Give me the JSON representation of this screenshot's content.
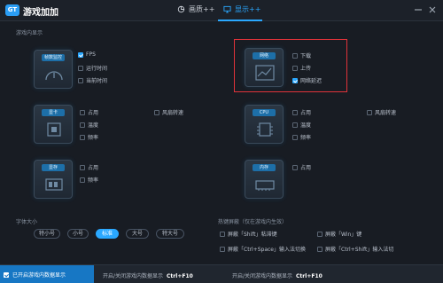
{
  "app": {
    "logo_text": "GT",
    "name": "游戏加加"
  },
  "tabs": [
    {
      "label": "画质++"
    },
    {
      "label": "显示++"
    }
  ],
  "section_display_title": "游戏内显示",
  "modules": {
    "fps": {
      "tile_label": "帧数监控",
      "options": [
        {
          "label": "FPS",
          "checked": true
        },
        {
          "label": "运行时间",
          "checked": false
        },
        {
          "label": "当前时间",
          "checked": false
        }
      ]
    },
    "network": {
      "tile_label": "网络",
      "options": [
        {
          "label": "下载",
          "checked": false
        },
        {
          "label": "上传",
          "checked": false
        },
        {
          "label": "网络延迟",
          "checked": true
        }
      ]
    },
    "gpu": {
      "tile_label": "显卡",
      "options": [
        {
          "label": "占用",
          "checked": false
        },
        {
          "label": "温度",
          "checked": false
        },
        {
          "label": "频率",
          "checked": false
        },
        {
          "label": "风扇转速",
          "checked": false
        }
      ]
    },
    "cpu": {
      "tile_label": "CPU",
      "options": [
        {
          "label": "占用",
          "checked": false
        },
        {
          "label": "温度",
          "checked": false
        },
        {
          "label": "频率",
          "checked": false
        },
        {
          "label": "风扇转速",
          "checked": false
        }
      ]
    },
    "vram": {
      "tile_label": "显存",
      "options": [
        {
          "label": "占用",
          "checked": false
        },
        {
          "label": "频率",
          "checked": false
        }
      ]
    },
    "ram": {
      "tile_label": "内存",
      "options": [
        {
          "label": "占用",
          "checked": false
        }
      ]
    }
  },
  "font_size": {
    "label": "字体大小",
    "options": [
      "特小号",
      "小号",
      "标准",
      "大号",
      "特大号"
    ],
    "selected": "标准"
  },
  "hotkey_block": {
    "label": "热键屏蔽（仅在游戏内生效）",
    "options": [
      {
        "label": "屏蔽「Shift」粘滞键",
        "checked": false
      },
      {
        "label": "屏蔽「Win」键",
        "checked": false
      },
      {
        "label": "屏蔽「Ctrl+Space」输入法切换",
        "checked": false
      },
      {
        "label": "屏蔽「Ctrl+Shift」输入法切",
        "checked": false
      }
    ]
  },
  "footer": {
    "enabled_label": "已开启游戏内数据显示",
    "hotkey_1": {
      "label": "开启/关闭游戏内数据显示",
      "key": "Ctrl+F10"
    },
    "hotkey_2": {
      "label": "开启/关闭游戏内数据显示",
      "key": "Ctrl+F10"
    }
  },
  "colors": {
    "accent": "#2aa8ff",
    "highlight": "#e0333a",
    "background": "#181c23"
  }
}
